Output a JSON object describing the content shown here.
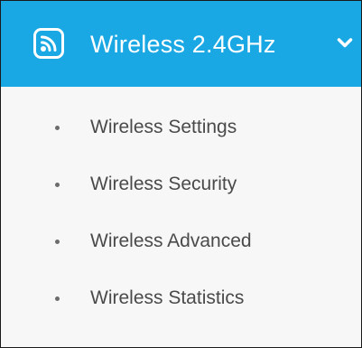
{
  "menu": {
    "header": {
      "title": "Wireless 2.4GHz",
      "icon": "wireless-signal-icon",
      "expand_icon": "chevron-down-icon",
      "background_color": "#1aa8e4",
      "text_color": "#ffffff"
    },
    "items": [
      {
        "label": "Wireless Settings",
        "icon": "bullet-icon"
      },
      {
        "label": "Wireless Security",
        "icon": "bullet-icon"
      },
      {
        "label": "Wireless Advanced",
        "icon": "bullet-icon"
      },
      {
        "label": "Wireless Statistics",
        "icon": "bullet-icon"
      }
    ],
    "item_text_color": "#4a4a4a",
    "submenu_background": "#f7f7f7"
  }
}
